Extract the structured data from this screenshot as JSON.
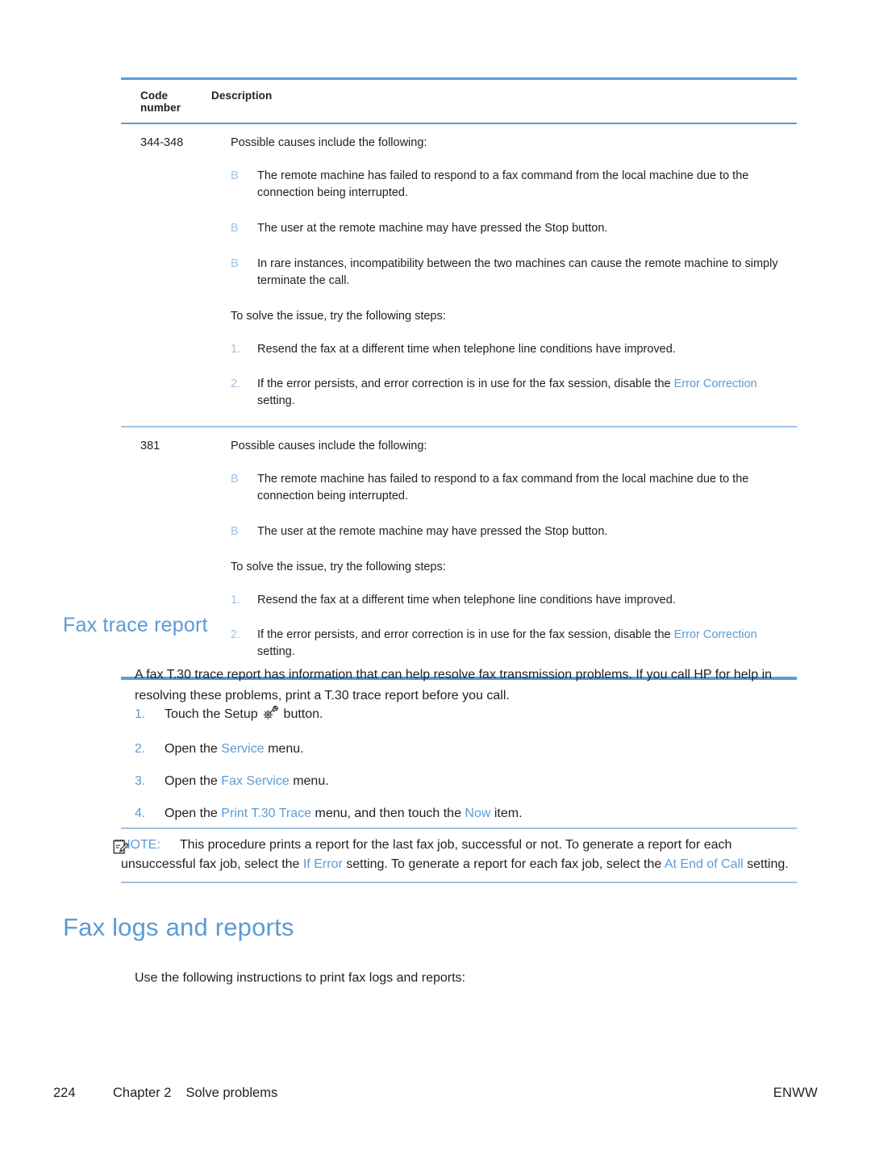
{
  "table": {
    "headers": {
      "code": "Code number",
      "description": "Description"
    },
    "rows": [
      {
        "code": "344-348",
        "lead": "Possible causes include the following:",
        "bullets": [
          {
            "marker": "B",
            "text": "The remote machine has failed to respond to a fax command from the local machine due to the connection being interrupted."
          },
          {
            "marker": "B",
            "text": "The user at the remote machine may have pressed the Stop button."
          },
          {
            "marker": "B",
            "text": "In rare instances, incompatibility between the two machines can cause the remote machine to simply terminate the call."
          }
        ],
        "steps_intro": "To solve the issue, try the following steps:",
        "steps": [
          {
            "marker": "1.",
            "text_before": "Resend the fax at a different time when telephone line conditions have improved.",
            "link": "",
            "text_after": ""
          },
          {
            "marker": "2.",
            "text_before": "If the error persists, and error correction is in use for the fax session, disable the ",
            "link": "Error Correction",
            "text_after": " setting."
          }
        ]
      },
      {
        "code": "381",
        "lead": "Possible causes include the following:",
        "bullets": [
          {
            "marker": "B",
            "text": "The remote machine has failed to respond to a fax command from the local machine due to the connection being interrupted."
          },
          {
            "marker": "B",
            "text": "The user at the remote machine may have pressed the Stop button."
          }
        ],
        "steps_intro": "To solve the issue, try the following steps:",
        "steps": [
          {
            "marker": "1.",
            "text_before": "Resend the fax at a different time when telephone line conditions have improved.",
            "link": "",
            "text_after": ""
          },
          {
            "marker": "2.",
            "text_before": "If the error persists, and error correction is in use for the fax session, disable the ",
            "link": "Error Correction",
            "text_after": " setting."
          }
        ]
      }
    ]
  },
  "fax_trace_section": {
    "heading": "Fax trace report",
    "paragraph": "A fax T.30 trace report has information that can help resolve fax transmission problems. If you call HP for help in resolving these problems, print a T.30 trace report before you call.",
    "steps": [
      {
        "marker": "1.",
        "before": "Touch the Setup ",
        "icon": "setup-gear-wrench-icon",
        "link": "",
        "middle": "",
        "link2": "",
        "after": " button."
      },
      {
        "marker": "2.",
        "before": "Open the ",
        "icon": "",
        "link": "Service",
        "middle": "",
        "link2": "",
        "after": " menu."
      },
      {
        "marker": "3.",
        "before": "Open the ",
        "icon": "",
        "link": "Fax Service",
        "middle": "",
        "link2": "",
        "after": " menu."
      },
      {
        "marker": "4.",
        "before": "Open the ",
        "icon": "",
        "link": "Print T.30 Trace",
        "middle": " menu, and then touch the ",
        "link2": "Now",
        "after": " item."
      }
    ]
  },
  "note": {
    "icon": "note-pencil-icon",
    "label": "NOTE:",
    "text_1": "This procedure prints a report for the last fax job, successful or not. To generate a report for each unsuccessful fax job, select the ",
    "link_1": "If Error",
    "text_2": " setting. To generate a report for each fax job, select the ",
    "link_2": "At End of Call",
    "text_3": " setting."
  },
  "fax_logs_section": {
    "heading": "Fax logs and reports",
    "paragraph": "Use the following instructions to print fax logs and reports:"
  },
  "footer": {
    "page_number": "224",
    "chapter": "Chapter 2",
    "chapter_title": "Solve problems",
    "right_label": "ENWW"
  },
  "colors": {
    "accent_blue": "#5b9bd5",
    "light_blue_rule": "#9dc3e6",
    "body_text": "#231f20"
  }
}
